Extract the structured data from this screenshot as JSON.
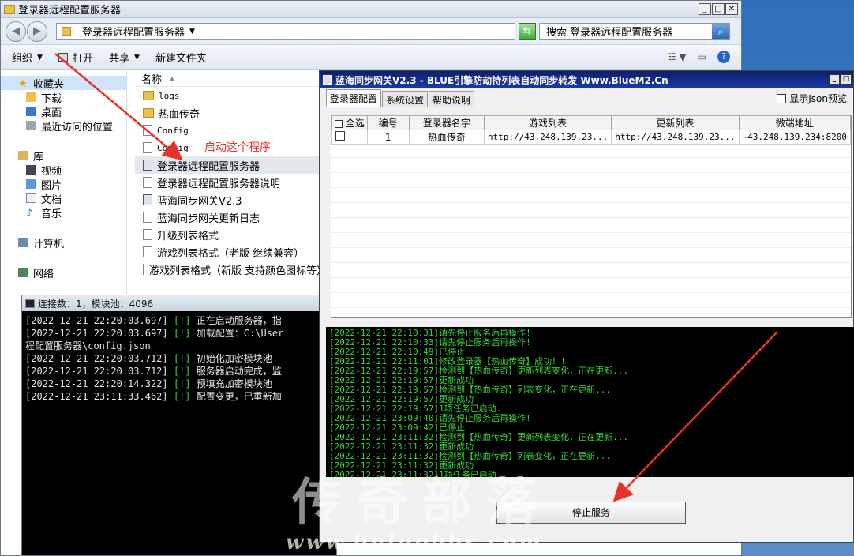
{
  "explorer": {
    "title": "登录器远程配置服务器",
    "address": "登录器远程配置服务器",
    "search_placeholder": "搜索 登录器远程配置服务器",
    "toolbar": {
      "organize": "组织",
      "open": "打开",
      "share": "共享",
      "new_folder": "新建文件夹"
    },
    "nav": {
      "favorites": "收藏夹",
      "fav_items": [
        "下载",
        "桌面",
        "最近访问的位置"
      ],
      "libraries": "库",
      "lib_items": [
        "视频",
        "图片",
        "文档",
        "音乐"
      ],
      "computer": "计算机",
      "network": "网络"
    },
    "column_name": "名称",
    "files": [
      {
        "name": "logs",
        "type": "folder"
      },
      {
        "name": "热血传奇",
        "type": "folder"
      },
      {
        "name": "Config",
        "type": "file"
      },
      {
        "name": "Config",
        "type": "file"
      },
      {
        "name": "登录器远程配置服务器",
        "type": "exe",
        "selected": true
      },
      {
        "name": "登录器远程配置服务器说明",
        "type": "file"
      },
      {
        "name": "蓝海同步网关V2.3",
        "type": "exe"
      },
      {
        "name": "蓝海同步网关更新日志",
        "type": "file"
      },
      {
        "name": "升级列表格式",
        "type": "file"
      },
      {
        "name": "游戏列表格式（老版 继续兼容）",
        "type": "file"
      },
      {
        "name": "游戏列表格式（新版 支持颜色图标等）",
        "type": "file"
      }
    ],
    "annotation": "启动这个程序"
  },
  "console": {
    "title": "连接数：1，模块池：4096",
    "lines": [
      {
        "time": "[2022-12-21 22:20:03.697]",
        "tag": "[!]",
        "msg": "正在启动服务器，指"
      },
      {
        "time": "[2022-12-21 22:20:03.697]",
        "tag": "[!]",
        "msg": "加载配置：C:\\User"
      },
      {
        "time": "",
        "tag": "",
        "msg": "程配置服务器\\config.json"
      },
      {
        "time": "[2022-12-21 22:20:03.712]",
        "tag": "[!]",
        "msg": "初始化加密模块池"
      },
      {
        "time": "[2022-12-21 22:20:03.712]",
        "tag": "[!]",
        "msg": "服务器启动完成，监"
      },
      {
        "time": "[2022-12-21 22:20:14.322]",
        "tag": "[!]",
        "msg": "预填充加密模块池"
      },
      {
        "time": "[2022-12-21 23:11:33.462]",
        "tag": "[!]",
        "msg": "配置变更，已重新加"
      }
    ]
  },
  "gateway": {
    "title": "蓝海同步网关V2.3 - BLUE引擎防劫持列表自动同步转发 Www.BlueM2.Cn",
    "tabs": [
      "登录器配置",
      "系统设置",
      "帮助说明"
    ],
    "json_preview": "显示Json预览",
    "columns": [
      "全选",
      "编号",
      "登录器名字",
      "游戏列表",
      "更新列表",
      "微端地址"
    ],
    "rows": [
      {
        "num": "1",
        "name": "热血传奇",
        "game_list": "http://43.248.139.23...",
        "update_list": "http://43.248.139.23...",
        "micro": "~43.248.139.234:8200"
      }
    ],
    "log": [
      {
        "t": "[2022-12-21 22:10:31]",
        "m": "请先停止服务后再操作!"
      },
      {
        "t": "[2022-12-21 22:10:33]",
        "m": "请先停止服务后再操作!"
      },
      {
        "t": "[2022-12-21 22:10:49]",
        "m": "已停止"
      },
      {
        "t": "[2022-12-21 22:11:01]",
        "m": "修改登录器【热血传奇】成功！!"
      },
      {
        "t": "[2022-12-21 22:19:57]",
        "m": "检测到【热血传奇】更新列表变化，正在更新..."
      },
      {
        "t": "[2022-12-21 22:19:57]",
        "m": "更新成功"
      },
      {
        "t": "[2022-12-21 22:19:57]",
        "m": "检测到【热血传奇】列表变化，正在更新..."
      },
      {
        "t": "[2022-12-21 22:19:57]",
        "m": "更新成功"
      },
      {
        "t": "[2022-12-21 22:19:57]",
        "m": "1项任务已启动."
      },
      {
        "t": "[2022-12-21 23:09:40]",
        "m": "请先停止服务后再操作!"
      },
      {
        "t": "[2022-12-21 23:09:42]",
        "m": "已停止"
      },
      {
        "t": "[2022-12-21 23:11:32]",
        "m": "检测到【热血传奇】更新列表变化，正在更新..."
      },
      {
        "t": "[2022-12-21 23:11:32]",
        "m": "更新成功"
      },
      {
        "t": "[2022-12-21 23:11:32]",
        "m": "检测到【热血传奇】列表变化，正在更新..."
      },
      {
        "t": "[2022-12-21 23:11:32]",
        "m": "更新成功"
      },
      {
        "t": "[2022-12-21 23:11:32]",
        "m": "1项任务已启动."
      }
    ],
    "stop_button": "停止服务"
  },
  "watermark": {
    "main": "传奇部落",
    "url": "www.buluobbs.com"
  },
  "colors": {
    "annotation_red": "#e8322a",
    "log_green": "#3ad43a",
    "title_blue": "#1a3aa8"
  }
}
